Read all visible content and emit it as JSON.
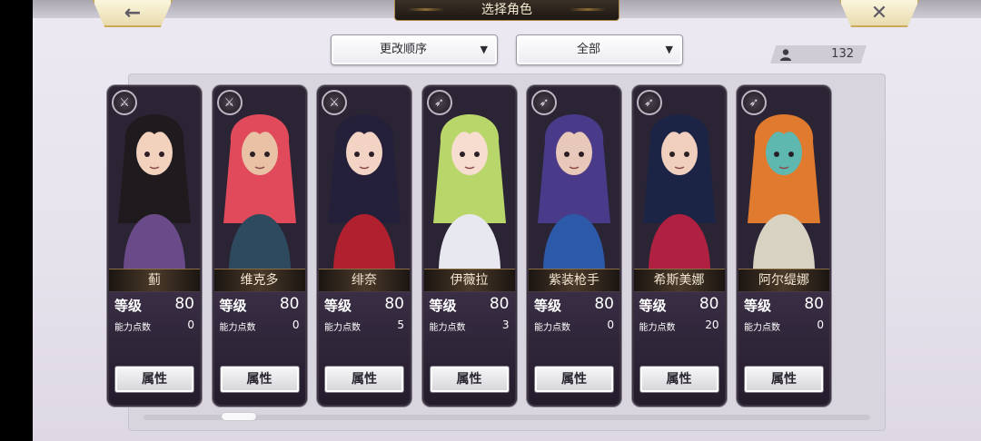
{
  "header": {
    "title": "选择角色",
    "back_icon": "←",
    "close_icon": "✕"
  },
  "controls": {
    "sort_value": "更改顺序",
    "filter_value": "全部",
    "caret": "▼",
    "character_count": "132"
  },
  "labels": {
    "level": "等级",
    "ability_points": "能力点数",
    "attributes_button": "属性"
  },
  "characters": [
    {
      "name": "蓟",
      "level": "80",
      "ability_points": "0",
      "hair": "#1e1a1e",
      "skin": "#f2d2bd",
      "accent": "#6b4a8a",
      "weapon": "⚔"
    },
    {
      "name": "维克多",
      "level": "80",
      "ability_points": "0",
      "hair": "#e04a5a",
      "skin": "#e9c2a6",
      "accent": "#2e4a5e",
      "weapon": "⚔"
    },
    {
      "name": "绯奈",
      "level": "80",
      "ability_points": "5",
      "hair": "#25203a",
      "skin": "#f2d3c4",
      "accent": "#b0202e",
      "weapon": "⚔"
    },
    {
      "name": "伊薇拉",
      "level": "80",
      "ability_points": "3",
      "hair": "#b9d66a",
      "skin": "#f6ddd0",
      "accent": "#e8e8f0",
      "weapon": "➶"
    },
    {
      "name": "紫装枪手",
      "level": "80",
      "ability_points": "0",
      "hair": "#4a3a8a",
      "skin": "#e8c8b8",
      "accent": "#2d5aa8",
      "weapon": "➶"
    },
    {
      "name": "希斯美娜",
      "level": "80",
      "ability_points": "20",
      "hair": "#1c2446",
      "skin": "#f0cfbf",
      "accent": "#b02040",
      "weapon": "➶"
    },
    {
      "name": "阿尔缇娜",
      "level": "80",
      "ability_points": "0",
      "hair": "#e07a2e",
      "skin": "#5fb8b0",
      "accent": "#d8d2c2",
      "weapon": "➶"
    }
  ]
}
